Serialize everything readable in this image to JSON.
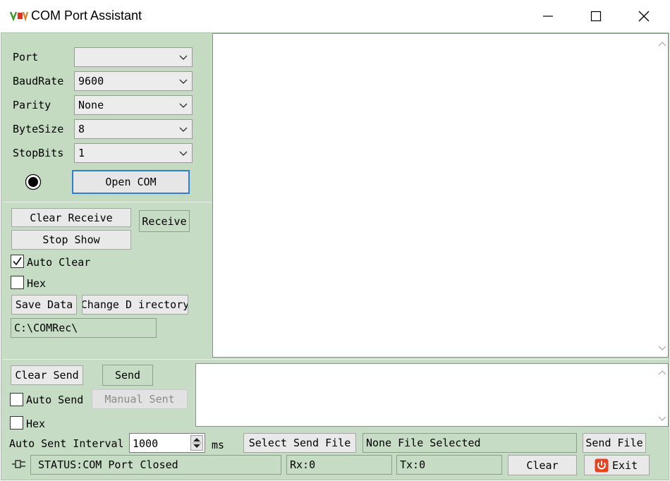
{
  "window": {
    "title": "COM Port Assistant"
  },
  "port_settings": {
    "port": {
      "label": "Port",
      "value": ""
    },
    "baudrate": {
      "label": "BaudRate",
      "value": "9600"
    },
    "parity": {
      "label": "Parity",
      "value": "None"
    },
    "bytesize": {
      "label": "ByteSize",
      "value": "8"
    },
    "stopbits": {
      "label": "StopBits",
      "value": "1"
    },
    "open_label": "Open COM"
  },
  "receive": {
    "clear_label": "Clear Receive",
    "receive_label": "Receive",
    "stop_show_label": "Stop Show",
    "auto_clear": {
      "label": "Auto Clear",
      "checked": true
    },
    "hex": {
      "label": "Hex",
      "checked": false
    },
    "save_label": "Save Data",
    "change_dir_label": "Change D irectory",
    "directory": "C:\\COMRec\\"
  },
  "send": {
    "clear_label": "Clear Send",
    "send_label": "Send",
    "auto_send": {
      "label": "Auto Send",
      "checked": false
    },
    "manual_label": "Manual Sent",
    "hex": {
      "label": "Hex",
      "checked": false
    },
    "interval_label": "Auto Sent Interval",
    "interval_value": "1000",
    "interval_unit": "ms",
    "select_file_label": "Select Send File",
    "file_name": "None File Selected",
    "send_file_label": "Send File"
  },
  "status": {
    "text": "STATUS:COM Port Closed",
    "rx": "Rx:0",
    "tx": "Tx:0",
    "clear_label": "Clear",
    "exit_label": "Exit"
  }
}
